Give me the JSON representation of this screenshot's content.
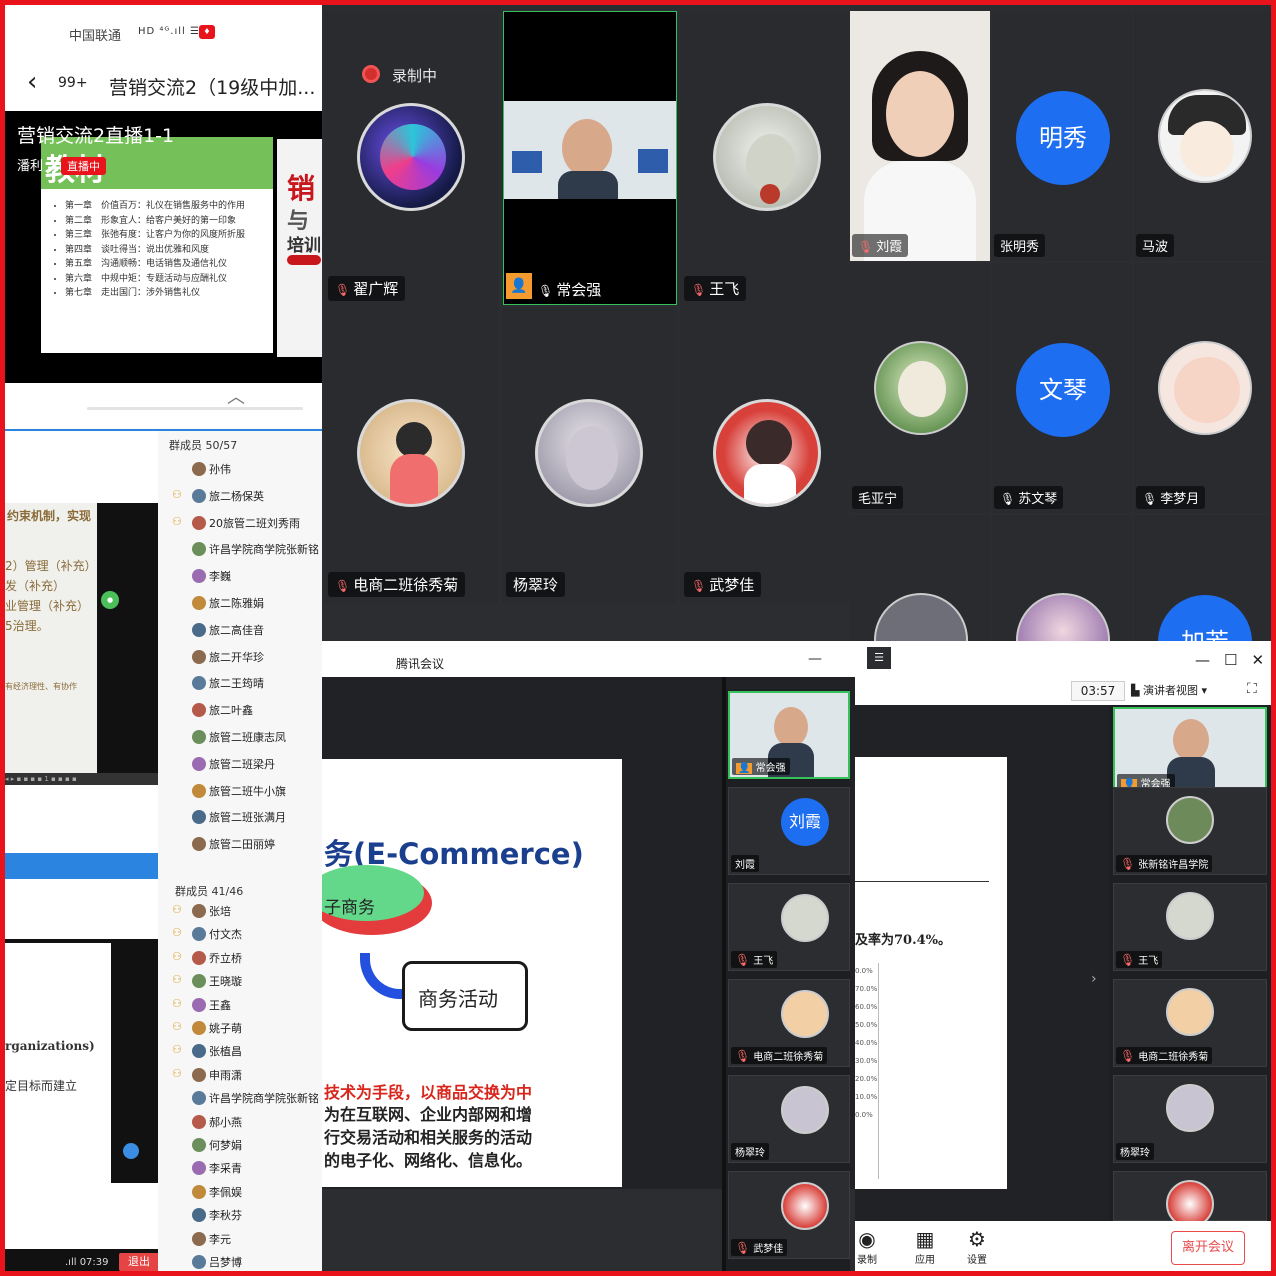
{
  "phone_chat": {
    "carrier": "中国联通",
    "status_icons": "HD ⁴ᴳ.ıll ☰",
    "back_icon": "chevron-left-icon",
    "unread_count": "99+",
    "chat_title": "营销交流2（19级中加...",
    "live_title": "营销交流2直播1-1",
    "presenter": "潘利",
    "slide_heading": "教材",
    "live_badge": "直播中",
    "toc": [
      "第一章　价值百万：礼仪在销售服务中的作用",
      "第二章　形象宜人：给客户美好的第一印象",
      "第三章　张弛有度：让客户为你的风度所折服",
      "第四章　谈吐得当：说出优雅和风度",
      "第五章　沟通顺畅：电话销售及通信礼仪",
      "第六章　中规中矩：专题活动与应酬礼仪",
      "第七章　走出国门：涉外销售礼仪"
    ],
    "side_card": {
      "t1": "销",
      "t2": "与",
      "t3": "培训"
    }
  },
  "member_list": {
    "doc1_lines": [
      "约束机制，实现",
      "2）管理（补充）",
      "发（补充）",
      "业管理（补充）",
      "5治理。",
      "有经济理性、有协作"
    ],
    "doc1_bottom": "◂ ▸ ▪ ▪ ▪ ▪ 1 ▪ ▪ ▪ ▪",
    "doc2_lines": [
      "rganizations)",
      "定目标而建立"
    ],
    "signal_time": ".ıll 07:39",
    "exit_label": "退出",
    "group1": {
      "header": "群成员 50/57",
      "members": [
        "孙伟",
        "旅二杨保英",
        "20旅管二班刘秀雨",
        "许昌学院商学院张新铭",
        "李巍",
        "旅二陈雅娟",
        "旅二高佳音",
        "旅二开华珍",
        "旅二王筠晴",
        "旅二叶鑫",
        "旅管二班康志凤",
        "旅管二班梁丹",
        "旅管二班牛小旗",
        "旅管二班张满月",
        "旅管二田丽婷"
      ]
    },
    "group2": {
      "header": "群成员 41/46",
      "members": [
        "张培",
        "付文杰",
        "乔立桥",
        "王晓璇",
        "王鑫",
        "姚子萌",
        "张植昌",
        "申雨潇",
        "许昌学院商学院张新铭",
        "郝小燕",
        "何梦娟",
        "李采青",
        "李佩娱",
        "李秋芬",
        "李元",
        "吕梦博"
      ]
    }
  },
  "meeting_grid_a": {
    "recording_label": "录制中",
    "tiles": [
      {
        "name": "翟广辉",
        "mic": "muted"
      },
      {
        "name": "常会强",
        "mic": "on",
        "video": true
      },
      {
        "name": "王飞",
        "mic": "muted"
      },
      {
        "name": "电商二班徐秀菊",
        "mic": "muted"
      },
      {
        "name": "杨翠玲",
        "mic": "none"
      },
      {
        "name": "武梦佳",
        "mic": "muted"
      }
    ]
  },
  "meeting_grid_b": {
    "tiles": [
      {
        "name": "刘霞",
        "mic": "muted",
        "video": true
      },
      {
        "name": "张明秀",
        "mic": "none",
        "initials": "明秀"
      },
      {
        "name": "马波",
        "mic": "none"
      },
      {
        "name": "毛亚宁",
        "mic": "none"
      },
      {
        "name": "苏文琴",
        "mic": "muted",
        "initials": "文琴"
      },
      {
        "name": "李梦月",
        "mic": "muted"
      },
      {
        "initials": "加芳"
      }
    ]
  },
  "slideshow": {
    "app_title": "腾讯会议",
    "window_min": "—",
    "slide_title": "务(E-Commerce)",
    "pill_text": "子商务",
    "box_text": "商务活动",
    "definition": [
      "技术为手段，以商品交换为中",
      "为在互联网、企业内部网和增",
      "行交易活动和相关服务的活动",
      "的电子化、网络化、信息化。"
    ],
    "participants": [
      {
        "name": "常会强",
        "video": true
      },
      {
        "name": "刘霞",
        "initials": "刘霞"
      },
      {
        "name": "王飞"
      },
      {
        "name": "电商二班徐秀菊"
      },
      {
        "name": "杨翠玲"
      },
      {
        "name": "武梦佳"
      }
    ]
  },
  "meeting_window": {
    "menu_icon": "☰",
    "window_controls": [
      "—",
      "☐",
      "✕"
    ],
    "timer": "03:57",
    "view_mode": "演讲者视图",
    "rate_text": "及率为70.4%。",
    "ticks": [
      "0.0%",
      "70.0%",
      "60.0%",
      "50.0%",
      "40.0%",
      "30.0%",
      "20.0%",
      "10.0%",
      "0.0%"
    ],
    "participants": [
      {
        "name": "常会强",
        "video": true
      },
      {
        "name": "张新铭许昌学院"
      },
      {
        "name": "王飞"
      },
      {
        "name": "电商二班徐秀菊"
      },
      {
        "name": "杨翠玲"
      }
    ],
    "footer": [
      {
        "label": "录制",
        "icon": "record-icon"
      },
      {
        "label": "应用",
        "icon": "apps-icon"
      },
      {
        "label": "设置",
        "icon": "gear-icon"
      }
    ],
    "leave_label": "离开会议"
  }
}
